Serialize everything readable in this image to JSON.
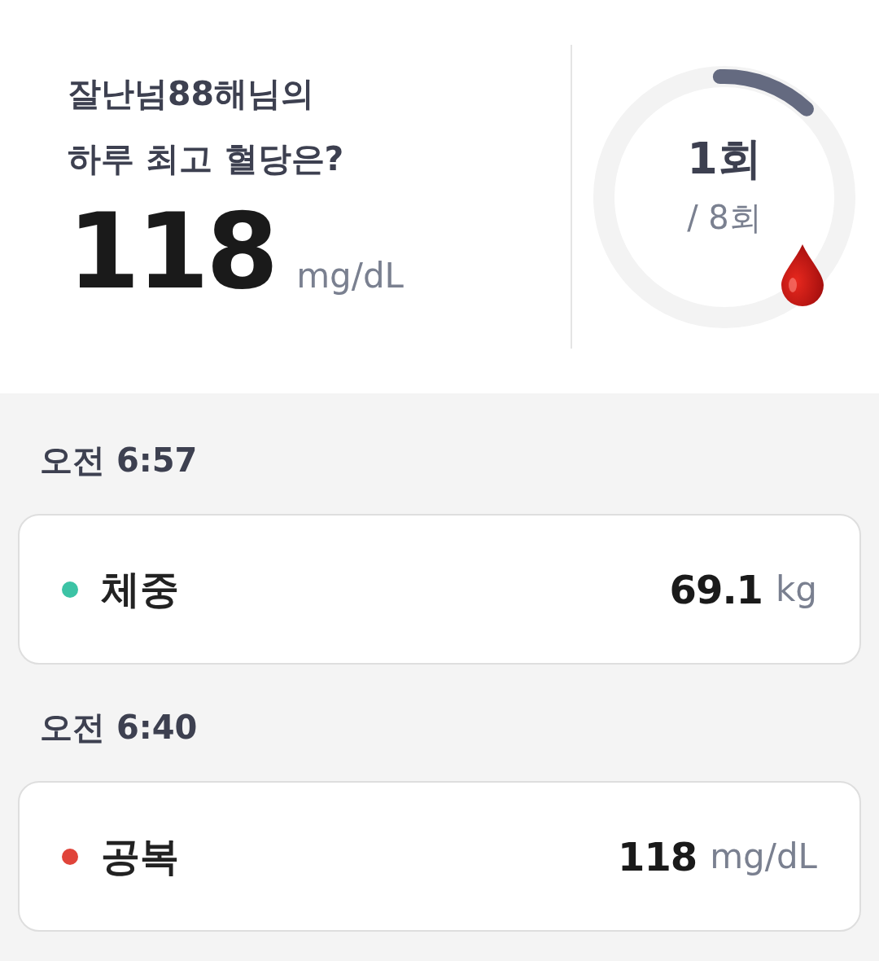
{
  "summary": {
    "title_lines": [
      "잘난넘88해님의",
      "하루 최고 혈당은?"
    ],
    "value": "118",
    "unit": "mg/dL"
  },
  "count": {
    "current": "1회",
    "total": "/ 8회",
    "level": 0.125
  },
  "records": [
    {
      "time": "오전 6:57",
      "label": "체중",
      "color": "#3cc3a5",
      "value": "69.1",
      "unit": "kg"
    },
    {
      "time": "오전 6:40",
      "label": "공복",
      "color": "#e0443a",
      "value": "118",
      "unit": "mg/dL"
    }
  ]
}
